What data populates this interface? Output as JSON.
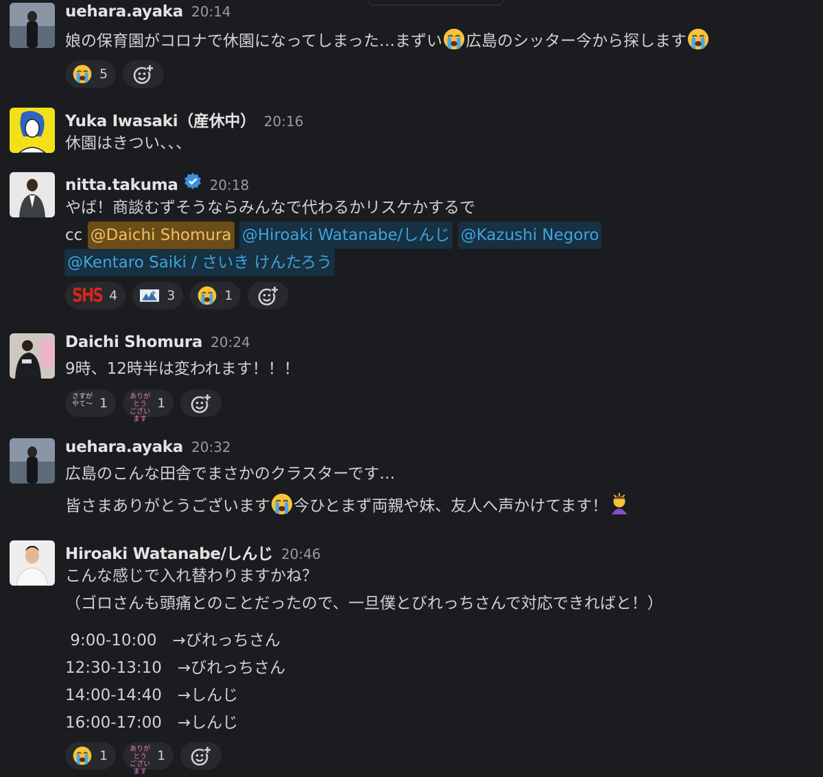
{
  "messages": [
    {
      "user": "uehara.ayaka",
      "time": "20:14",
      "lines": [
        "娘の保育園がコロナで休園になってしまった…まずい",
        "広島のシッター今から探します"
      ],
      "reactions": [
        {
          "emoji": "sob-emoji",
          "count": "5"
        }
      ]
    },
    {
      "user": "Yuka Iwasaki（産休中）",
      "time": "20:16",
      "lines": [
        "休園はきつい、、、"
      ]
    },
    {
      "user": "nitta.takuma",
      "time": "20:18",
      "lines": [
        "やば！商談むずそうならみんなで代わるかリスケかするで",
        "cc"
      ],
      "mentions": [
        "@Daichi Shomura",
        "@Hiroaki Watanabe/しんじ",
        "@Kazushi Negoro",
        "@Kentaro Saiki / さいき けんたろう"
      ],
      "reactions": [
        {
          "emoji": "shs-emoji",
          "label": "SHS",
          "count": "4"
        },
        {
          "emoji": "custom-image-emoji",
          "count": "3"
        },
        {
          "emoji": "sob-emoji",
          "count": "1"
        }
      ]
    },
    {
      "user": "Daichi Shomura",
      "time": "20:24",
      "lines": [
        "9時、12時半は変われます！！！"
      ],
      "reactions": [
        {
          "emoji": "sasuga-emoji",
          "label_top": "さすが",
          "label_bottom": "やて〜",
          "count": "1"
        },
        {
          "emoji": "arigatou-emoji",
          "label_top": "ありがとう",
          "label_bottom": "ございます",
          "count": "1"
        }
      ]
    },
    {
      "user": "uehara.ayaka",
      "time": "20:32",
      "lines": [
        "広島のこんな田舎でまさかのクラスターです…",
        "皆さまありがとうございます",
        "今ひとまず両親や妹、友人へ声かけてます！"
      ]
    },
    {
      "user": "Hiroaki Watanabe/しんじ",
      "time": "20:46",
      "lines": [
        "こんな感じで入れ替わりますかね？",
        "（ゴロさんも頭痛とのことだったので、一旦僕とびれっちさんで対応できればと！）",
        " 9:00-10:00　→びれっちさん",
        "12:30-13:10　→びれっちさん",
        "14:00-14:40　→しんじ",
        "16:00-17:00　→しんじ"
      ],
      "reactions": [
        {
          "emoji": "sob-emoji",
          "count": "1"
        },
        {
          "emoji": "arigatou-emoji",
          "label_top": "ありがとう",
          "label_bottom": "ございます",
          "count": "1"
        }
      ]
    }
  ],
  "colors": {
    "background": "#1b1c1f",
    "mention_bg": "#173042",
    "mention_text": "#3fa4dc",
    "self_mention_bg": "#6b4d1a",
    "self_mention_text": "#f0c060",
    "verified": "#3d8fe0"
  }
}
